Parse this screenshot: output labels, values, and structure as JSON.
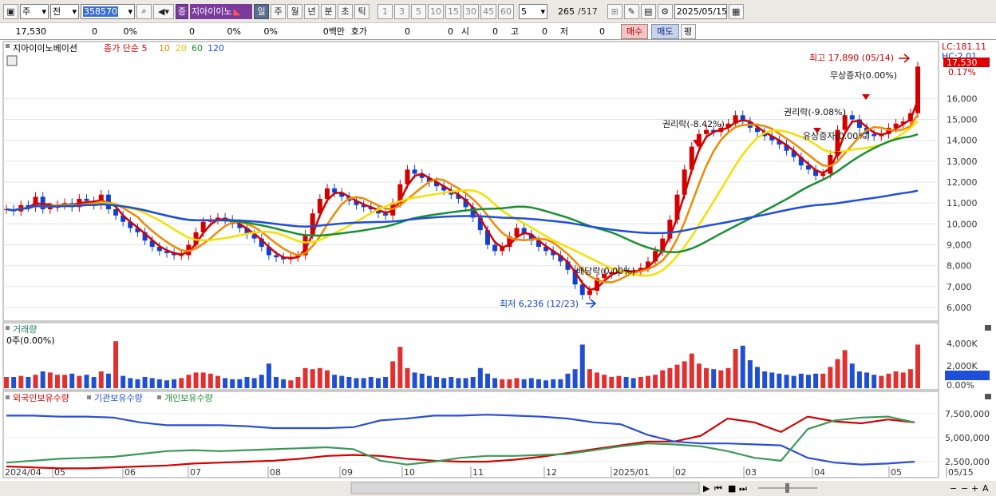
{
  "toolbar": {
    "market_type": "주",
    "prev_label": "전",
    "code": "358570",
    "name": "지아이이노",
    "periods": [
      "일",
      "주",
      "월",
      "년",
      "분",
      "초",
      "틱"
    ],
    "active_period": "일",
    "intervals": [
      "1",
      "3",
      "5",
      "10",
      "15",
      "30",
      "45",
      "60"
    ],
    "interval_value": "5",
    "count": "265",
    "count_total": "/517",
    "date": "2025/05/15"
  },
  "quote": {
    "price": "17,530",
    "change": "0",
    "change_pct": "0%",
    "volume": "0",
    "vol_pct": "0%",
    "vol_pct2": "0%",
    "amount": "0백만",
    "hoga_label": "호가",
    "hoga1": "0",
    "hoga2": "0",
    "open_label": "시",
    "open": "0",
    "high_label": "고",
    "high": "0",
    "low_label": "저",
    "low": "0",
    "buy": "매수",
    "sell": "매도",
    "avg": "평"
  },
  "colors": {
    "up": "#d40000",
    "down": "#1040d0",
    "ma5": "#d40000",
    "ma10": "#ef8a00",
    "ma20": "#f5e000",
    "ma60": "#179030",
    "ma120": "#1f4fd8",
    "vol_up": "#e03030",
    "vol_down": "#2050d0"
  },
  "chart_data": [
    {
      "type": "candlestick",
      "legend": {
        "title": "지아이이노베이션",
        "price_label": "종가",
        "ma_type": "단순",
        "ma_periods": [
          "5",
          "10",
          "20",
          "60",
          "120"
        ]
      },
      "ylim": [
        5500,
        18500
      ],
      "y_ticks": [
        "6,000",
        "7,000",
        "8,000",
        "9,000",
        "10,000",
        "11,000",
        "12,000",
        "13,000",
        "14,000",
        "15,000",
        "16,000"
      ],
      "lc_label": "LC:181.11",
      "hc_label": "HC:2.01",
      "last_price": "17,530",
      "last_pct": "0.17%",
      "annotations": [
        {
          "text": "최고 17,890 (05/14)",
          "value": 17890
        },
        {
          "text": "최저 6,236 (12/23)",
          "value": 6236
        },
        {
          "text": "무상증자(0.00%)"
        },
        {
          "text": "권리락(-9.08%)"
        },
        {
          "text": "권리락(-8.42%)"
        },
        {
          "text": "유상증자(0.00%)"
        },
        {
          "text": "배당락(0.00%)"
        }
      ],
      "close": [
        10700,
        10600,
        10900,
        10800,
        11300,
        10700,
        10800,
        10900,
        11000,
        10800,
        11200,
        11100,
        10900,
        11400,
        10700,
        10400,
        10100,
        9800,
        9600,
        9200,
        8900,
        8700,
        8600,
        8500,
        8500,
        9000,
        9600,
        10100,
        10200,
        10300,
        10200,
        10000,
        9800,
        9500,
        9300,
        8900,
        8500,
        8400,
        8300,
        8400,
        8500,
        9500,
        10500,
        11200,
        11700,
        11500,
        11300,
        11100,
        10900,
        10800,
        10700,
        10500,
        10400,
        11000,
        11900,
        12600,
        12400,
        12200,
        12000,
        11800,
        11600,
        11400,
        11200,
        10800,
        10300,
        9700,
        9000,
        8700,
        8900,
        9400,
        9800,
        9500,
        9200,
        8900,
        8700,
        8500,
        8200,
        7800,
        7100,
        6600,
        6800,
        7400,
        7600,
        7700,
        7800,
        7700,
        7700,
        7900,
        8200,
        8700,
        9300,
        10200,
        11400,
        12600,
        13700,
        14300,
        14500,
        14400,
        14600,
        14800,
        15200,
        14900,
        14600,
        14400,
        14200,
        14000,
        13800,
        13500,
        13200,
        12800,
        12600,
        12300,
        12400,
        13300,
        14500,
        15200,
        15000,
        14600,
        14300,
        14200,
        14300,
        14600,
        14800,
        14900,
        15300,
        17530
      ]
    },
    {
      "type": "bar",
      "title": "거래량",
      "subtitle": "0주(0.00%)",
      "y_ticks": [
        "4,000K",
        "2,000K",
        "0",
        "0.00%"
      ],
      "ylim": [
        0,
        5000
      ],
      "values": [
        1000,
        1000,
        1100,
        1000,
        1200,
        1500,
        1400,
        1200,
        1200,
        1300,
        1100,
        1200,
        1000,
        1500,
        1300,
        4200,
        1100,
        900,
        800,
        1000,
        900,
        800,
        700,
        800,
        900,
        1200,
        1400,
        1400,
        1300,
        1100,
        900,
        800,
        800,
        1000,
        900,
        1200,
        2200,
        1000,
        800,
        700,
        1000,
        1800,
        1700,
        1800,
        1600,
        1200,
        1100,
        1000,
        900,
        900,
        1000,
        900,
        1000,
        2400,
        3700,
        1800,
        1400,
        1300,
        1100,
        1000,
        900,
        1000,
        900,
        900,
        1000,
        1800,
        1300,
        900,
        800,
        800,
        900,
        800,
        900,
        800,
        700,
        800,
        800,
        1300,
        1700,
        3900,
        1700,
        1400,
        1200,
        1000,
        1100,
        1000,
        900,
        1000,
        1100,
        1200,
        1600,
        1800,
        2100,
        2400,
        3100,
        2200,
        1800,
        1700,
        1600,
        1800,
        3500,
        3800,
        2500,
        1900,
        1500,
        1400,
        1300,
        1200,
        1100,
        1300,
        1200,
        1300,
        1300,
        1900,
        2600,
        3400,
        2200,
        1500,
        1400,
        1200,
        1100,
        1300,
        1500,
        1400,
        1700,
        3900
      ],
      "up": [
        true,
        false,
        true,
        false,
        true,
        false,
        true,
        true,
        true,
        false,
        true,
        false,
        false,
        true,
        false,
        true,
        false,
        false,
        false,
        false,
        false,
        false,
        false,
        false,
        true,
        true,
        true,
        true,
        true,
        true,
        false,
        false,
        false,
        false,
        false,
        false,
        false,
        false,
        false,
        true,
        true,
        true,
        true,
        true,
        true,
        false,
        false,
        false,
        false,
        false,
        false,
        false,
        false,
        true,
        true,
        true,
        false,
        false,
        false,
        false,
        false,
        false,
        false,
        false,
        false,
        false,
        false,
        false,
        true,
        true,
        true,
        false,
        false,
        false,
        false,
        false,
        false,
        false,
        false,
        false,
        true,
        true,
        true,
        true,
        true,
        false,
        false,
        true,
        true,
        true,
        true,
        true,
        true,
        true,
        true,
        true,
        true,
        false,
        true,
        true,
        true,
        false,
        false,
        false,
        false,
        false,
        false,
        false,
        false,
        false,
        false,
        false,
        true,
        true,
        true,
        true,
        false,
        false,
        false,
        false,
        true,
        true,
        true,
        true,
        true,
        true
      ]
    },
    {
      "type": "line",
      "legend": [
        "외국인보유수량",
        "기관보유수량",
        "개인보유수량"
      ],
      "ylim": [
        1000000,
        8500000
      ],
      "y_ticks": [
        "7,500,000",
        "5,000,000",
        "2,500,000"
      ],
      "x_labels": [
        "2024/04",
        "05",
        "06",
        "07",
        "08",
        "09",
        "10",
        "11",
        "12",
        "2025/01",
        "02",
        "03",
        "04",
        "05",
        "05/15"
      ],
      "series": [
        {
          "name": "외국인보유수량",
          "values": [
            2000000,
            1900000,
            1800000,
            1800000,
            1900000,
            2000000,
            2100000,
            2300000,
            2400000,
            2500000,
            2600000,
            2800000,
            3100000,
            3200000,
            3100000,
            2800000,
            2600000,
            2500000,
            2500000,
            2700000,
            3000000,
            3400000,
            3800000,
            4200000,
            4600000,
            4600000,
            5200000,
            7000000,
            6600000,
            5600000,
            7200000,
            6700000,
            6500000,
            6900000,
            6600000
          ]
        },
        {
          "name": "기관보유수량",
          "values": [
            7300000,
            7300000,
            7200000,
            7200000,
            7100000,
            6600000,
            6300000,
            6300000,
            6300000,
            6200000,
            6000000,
            6000000,
            6000000,
            6100000,
            6800000,
            7000000,
            7300000,
            7300000,
            7400000,
            7300000,
            7200000,
            7000000,
            6600000,
            6400000,
            5300000,
            4600000,
            4400000,
            4400000,
            4300000,
            4200000,
            2900000,
            2400000,
            2200000,
            2300000,
            2500000
          ]
        },
        {
          "name": "개인보유수량",
          "values": [
            2400000,
            2600000,
            2800000,
            2900000,
            3000000,
            3300000,
            3600000,
            3700000,
            3600000,
            3700000,
            3800000,
            3900000,
            4000000,
            3800000,
            2600000,
            2200000,
            2500000,
            2900000,
            3100000,
            3100000,
            3200000,
            3300000,
            3700000,
            4100000,
            4400000,
            4300000,
            4100000,
            3600000,
            2900000,
            2600000,
            5900000,
            6800000,
            7100000,
            7200000,
            6600000
          ]
        }
      ]
    }
  ],
  "icons": [
    "chart-type-icon",
    "search-icon",
    "sound-icon",
    "dropdown-icon",
    "crosshair-icon",
    "tools-icon",
    "save-icon",
    "gear-icon",
    "calendar-icon",
    "menu-icon",
    "scroll-left-icon",
    "scroll-right-icon",
    "zoom-out-icon",
    "zoom-in-icon"
  ]
}
